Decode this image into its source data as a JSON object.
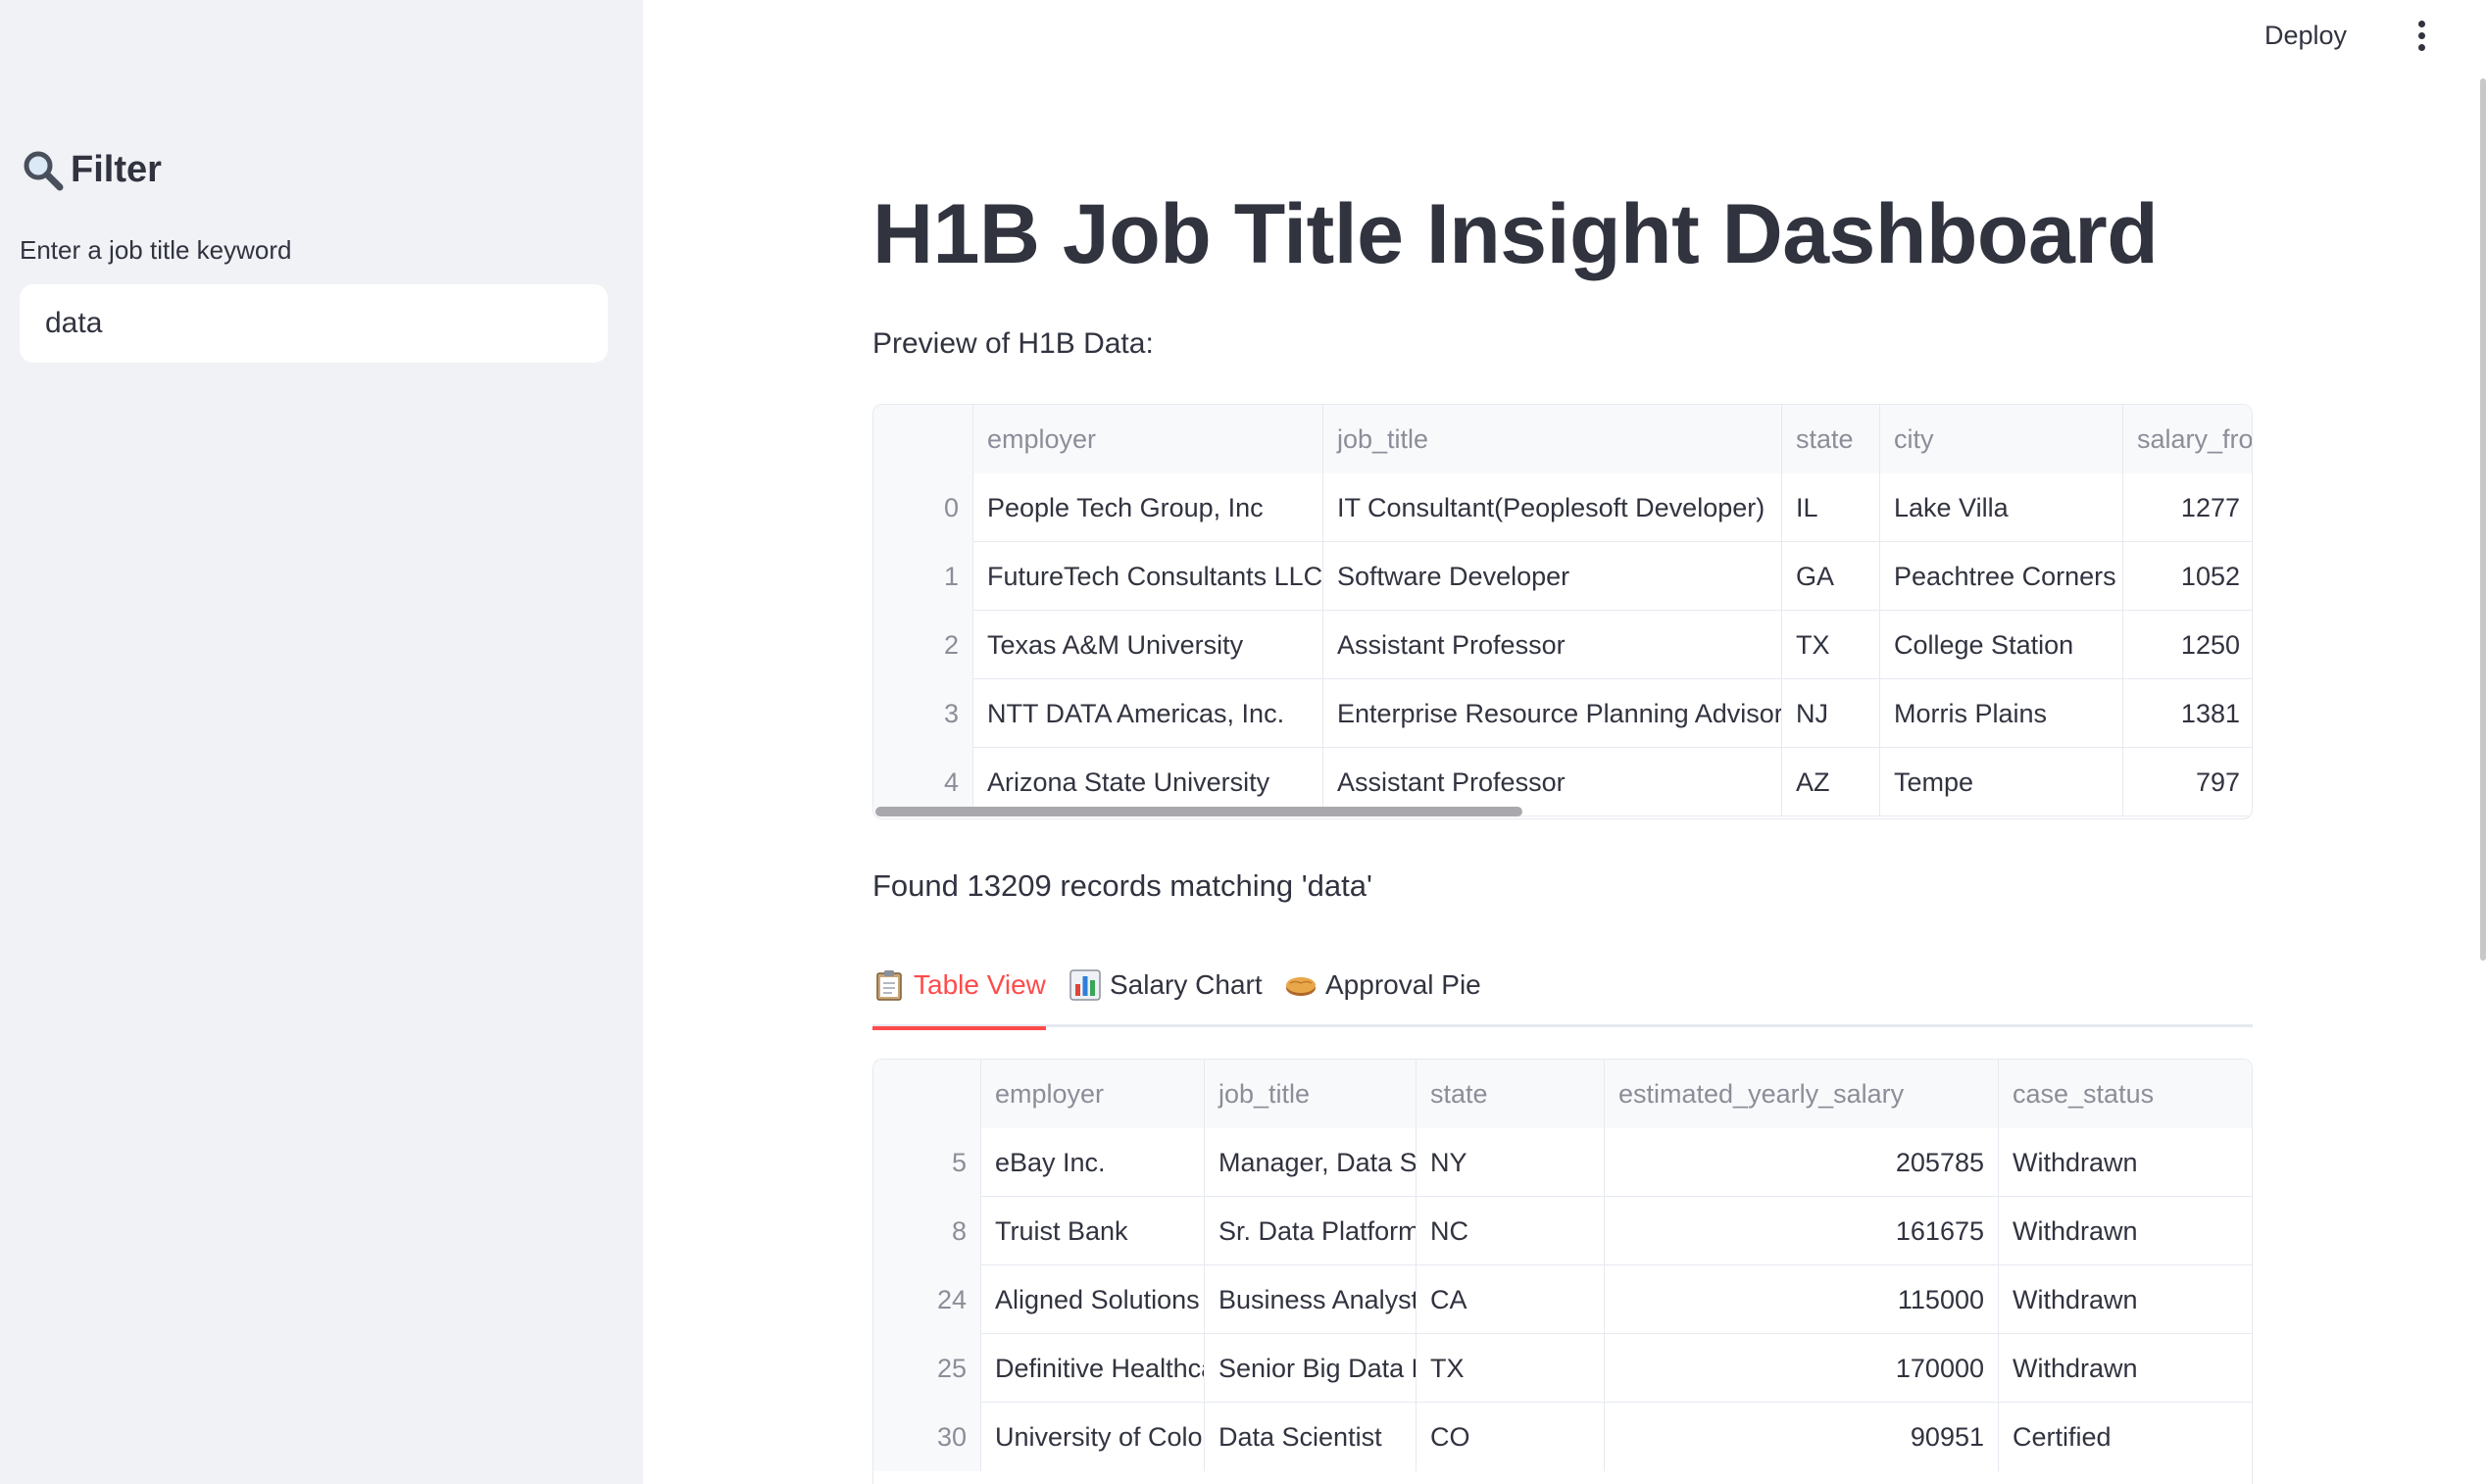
{
  "sidebar": {
    "title": "Filter",
    "title_icon": "magnifier-icon",
    "input_label": "Enter a job title keyword",
    "input_value": "data"
  },
  "header": {
    "deploy_label": "Deploy",
    "menu_icon": "kebab-menu-icon"
  },
  "main": {
    "title": "H1B Job Title Insight Dashboard",
    "preview_label": "Preview of H1B Data:",
    "preview_table": {
      "columns": [
        "",
        "employer",
        "job_title",
        "state",
        "city",
        "salary_fro"
      ],
      "rows": [
        [
          "0",
          "People Tech Group, Inc",
          "IT Consultant(Peoplesoft Developer)",
          "IL",
          "Lake Villa",
          "1277"
        ],
        [
          "1",
          "FutureTech Consultants LLC",
          "Software Developer",
          "GA",
          "Peachtree Corners",
          "1052"
        ],
        [
          "2",
          "Texas A&M University",
          "Assistant Professor",
          "TX",
          "College Station",
          "1250"
        ],
        [
          "3",
          "NTT DATA Americas, Inc.",
          "Enterprise Resource Planning Advisor",
          "NJ",
          "Morris Plains",
          "1381"
        ],
        [
          "4",
          "Arizona State University",
          "Assistant Professor",
          "AZ",
          "Tempe",
          "797"
        ]
      ]
    },
    "found_text": "Found 13209 records matching 'data'",
    "tabs": [
      {
        "label": "Table View",
        "icon": "clipboard-icon",
        "active": true
      },
      {
        "label": "Salary Chart",
        "icon": "bar-chart-icon",
        "active": false
      },
      {
        "label": "Approval Pie",
        "icon": "pie-icon",
        "active": false
      }
    ],
    "results_table": {
      "columns": [
        "",
        "employer",
        "job_title",
        "state",
        "estimated_yearly_salary",
        "case_status"
      ],
      "rows": [
        [
          "5",
          "eBay Inc.",
          "Manager, Data Sc",
          "NY",
          "205785",
          "Withdrawn"
        ],
        [
          "8",
          "Truist Bank",
          "Sr. Data Platform",
          "NC",
          "161675",
          "Withdrawn"
        ],
        [
          "24",
          "Aligned Solutions",
          "Business Analyst",
          "CA",
          "115000",
          "Withdrawn"
        ],
        [
          "25",
          "Definitive Healthca",
          "Senior Big Data E",
          "TX",
          "170000",
          "Withdrawn"
        ],
        [
          "30",
          "University of Color",
          "Data Scientist",
          "CO",
          "90951",
          "Certified"
        ]
      ]
    }
  },
  "colors": {
    "accent": "#ff4b4b",
    "sidebar_bg": "#f0f2f6",
    "text": "#31333f"
  }
}
